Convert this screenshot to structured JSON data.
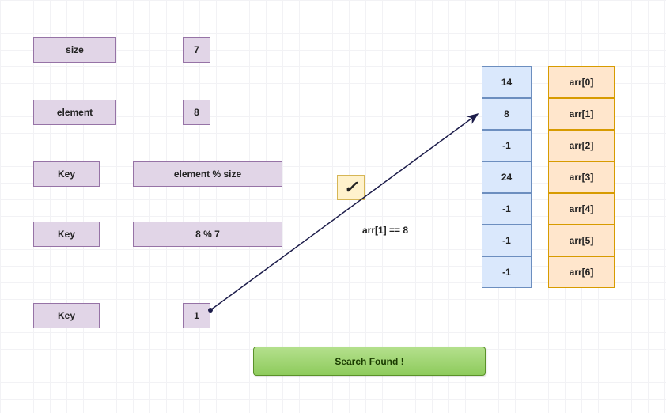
{
  "labels": {
    "size": "size",
    "element": "element",
    "key1": "Key",
    "key2": "Key",
    "key3": "Key",
    "formula": "element % size",
    "calc": "8 % 7",
    "sizeVal": "7",
    "elementVal": "8",
    "keyVal": "1",
    "check": "✓",
    "condition": "arr[1] == 8",
    "result": "Search Found !"
  },
  "array": {
    "values": [
      "14",
      "8",
      "-1",
      "24",
      "-1",
      "-1",
      "-1"
    ],
    "names": [
      "arr[0]",
      "arr[1]",
      "arr[2]",
      "arr[3]",
      "arr[4]",
      "arr[5]",
      "arr[6]"
    ]
  }
}
